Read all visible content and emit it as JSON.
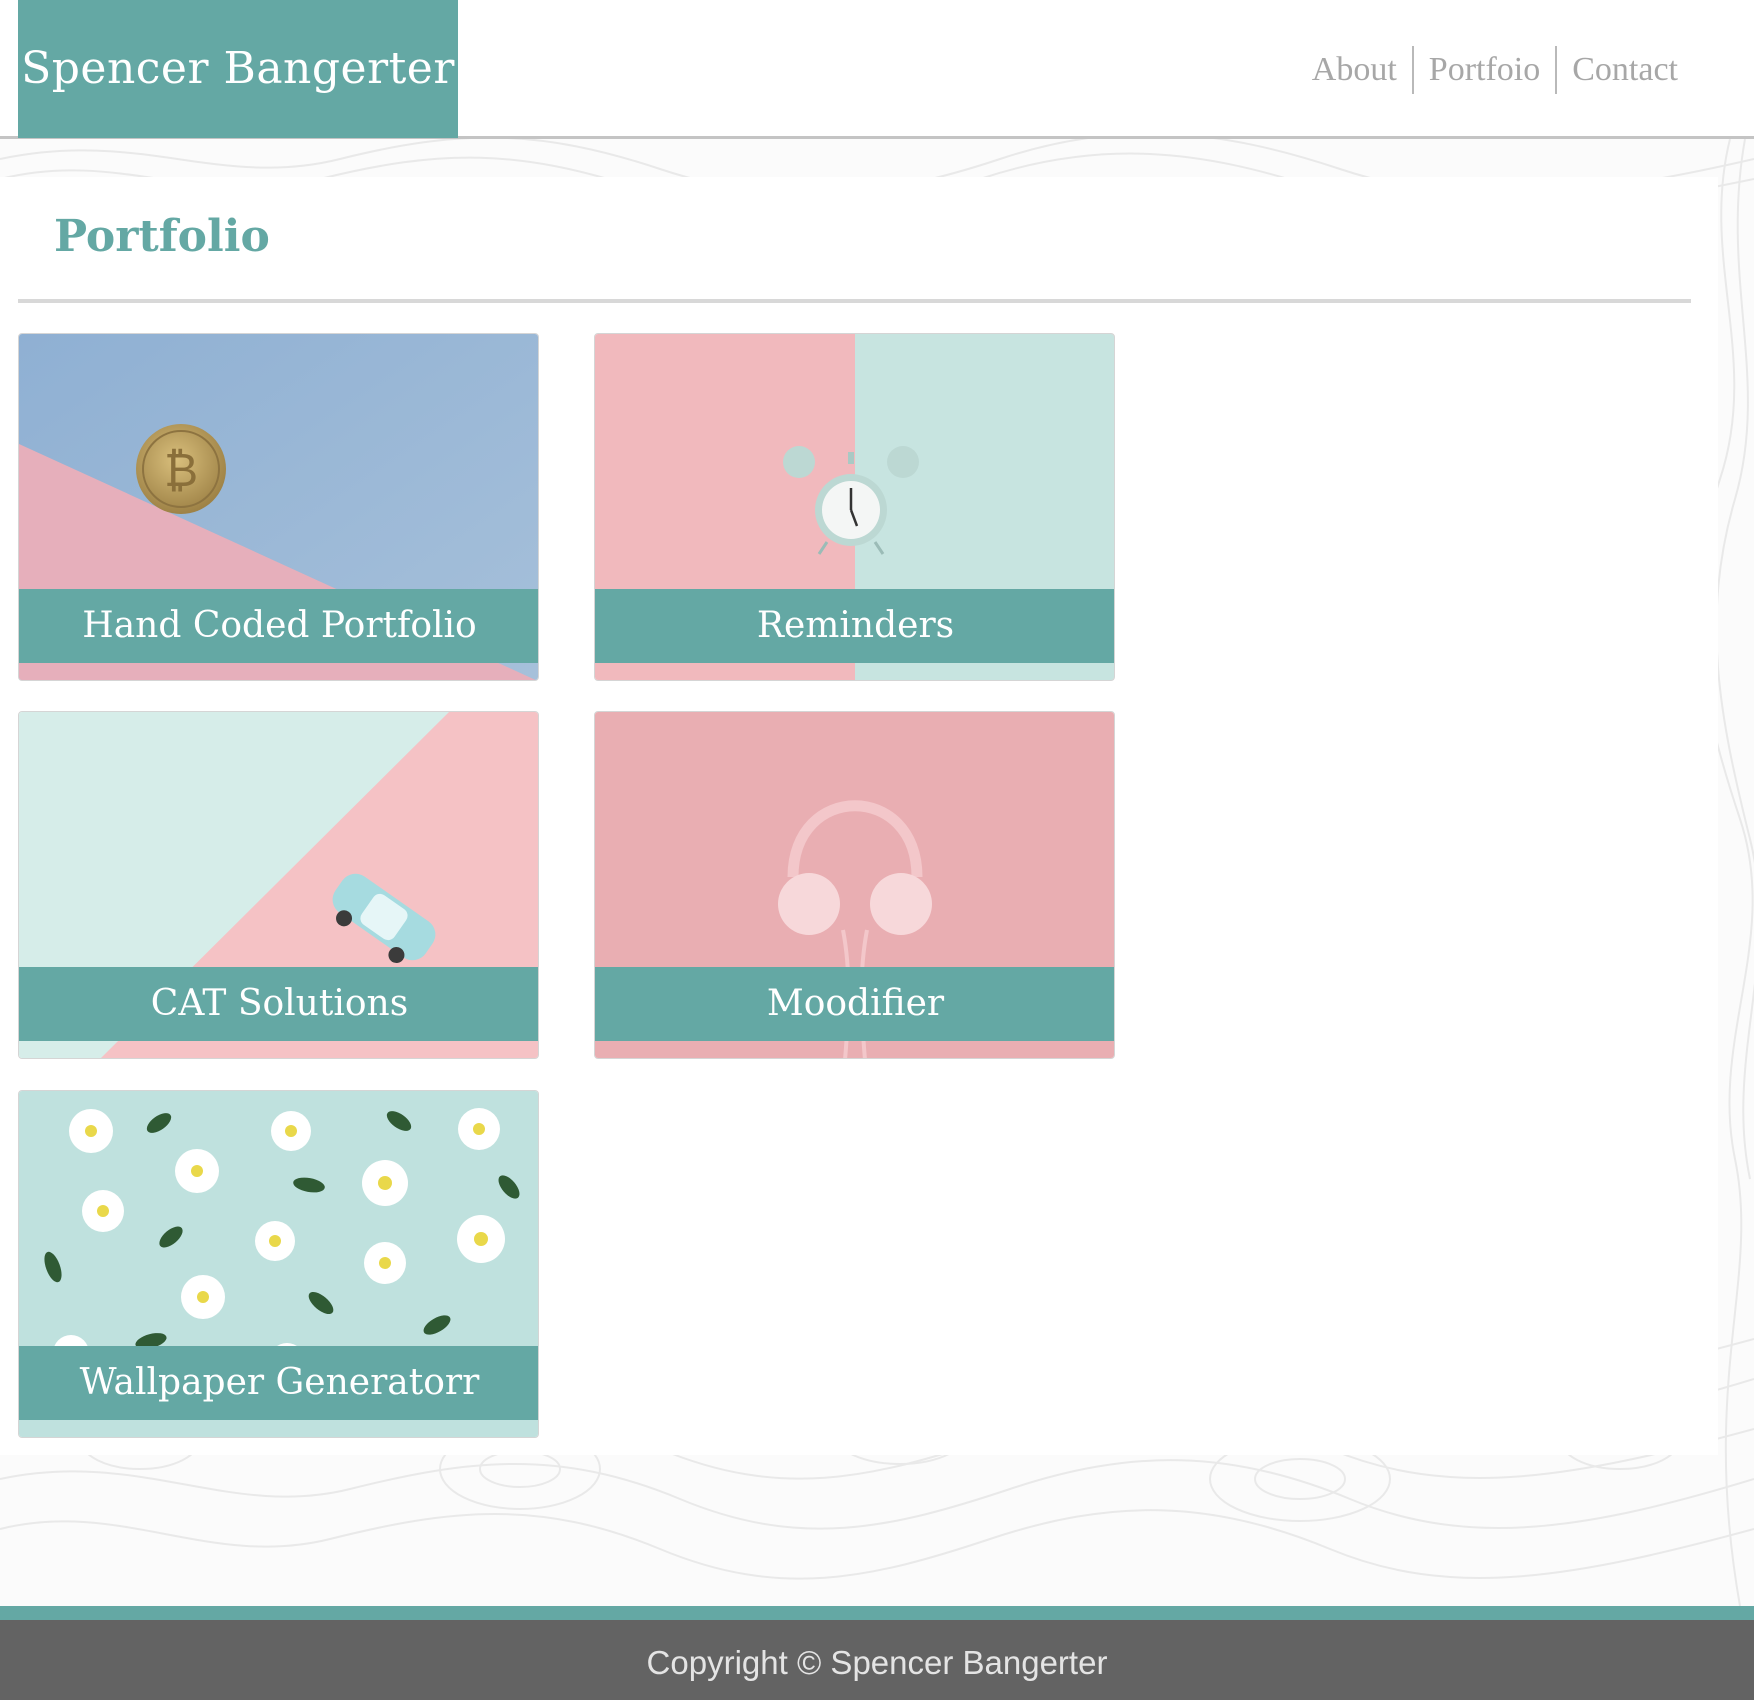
{
  "header": {
    "brand": "Spencer Bangerter",
    "nav": [
      {
        "label": "About"
      },
      {
        "label": "Portfoio"
      },
      {
        "label": "Contact"
      }
    ]
  },
  "main": {
    "title": "Portfolio",
    "projects": [
      {
        "title": "Hand Coded Portfolio",
        "image": "bitcoin-coin-on-blue-pink"
      },
      {
        "title": "Reminders",
        "image": "alarm-clock-on-pink-mint"
      },
      {
        "title": "CAT Solutions",
        "image": "toy-car-on-mint-pink"
      },
      {
        "title": "Moodifier",
        "image": "headphones-on-pink"
      },
      {
        "title": "Wallpaper Generatorr",
        "image": "daisies-and-leaves-on-mint"
      }
    ]
  },
  "footer": {
    "copyright": "Copyright © Spencer Bangerter"
  },
  "colors": {
    "accent": "#64a8a4",
    "nav_text": "#a7a7a7",
    "footer_bg": "#636363",
    "pink": "#f2bcbf",
    "mint": "#cde8e5",
    "blue": "#9ab8d4"
  }
}
